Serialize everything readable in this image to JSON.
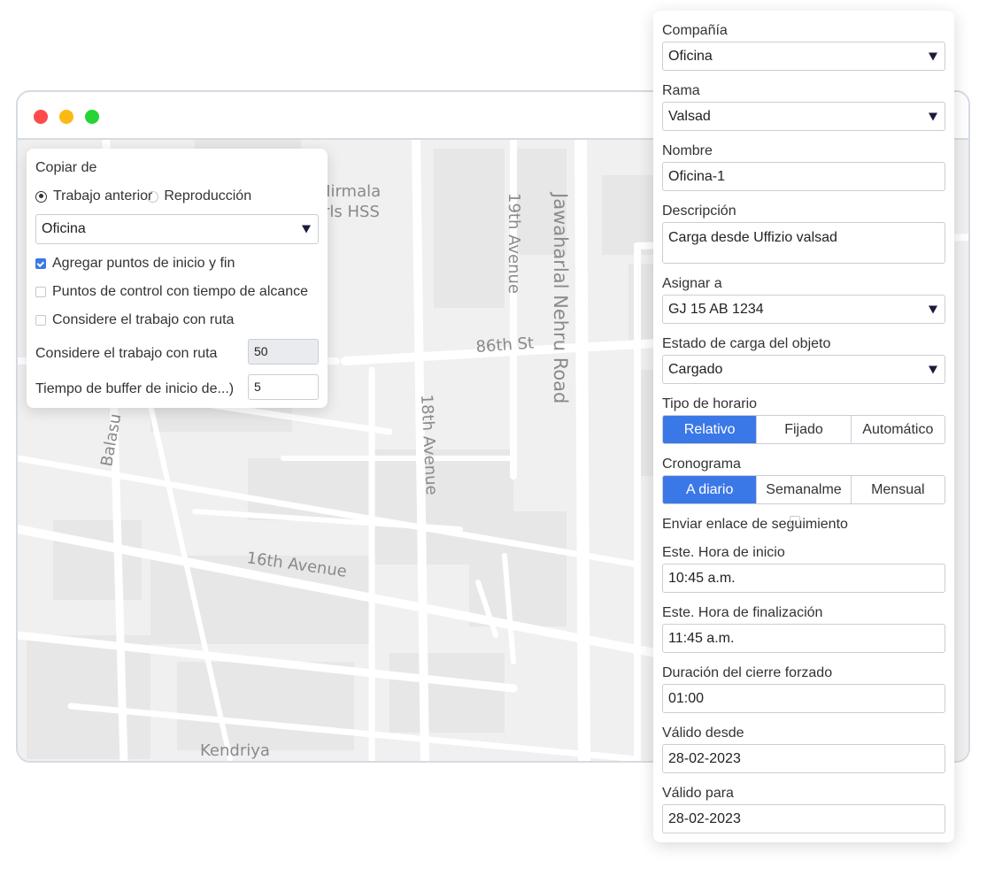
{
  "window": {
    "controls": [
      "close",
      "minimize",
      "maximize"
    ]
  },
  "map": {
    "labels": {
      "nirmala": "Nirmala",
      "girls_hss": "irls HSS",
      "nineteenth_avenue": "19th Avenue",
      "jawaharlal": "Jawaharlal Nehru Road",
      "eighty_sixth": "86th St",
      "eighteenth_avenue": "18th Avenue",
      "sixteenth_avenue": "16th Avenue",
      "balasu": "Balasu",
      "kendriya": "Kendriya"
    }
  },
  "copy_panel": {
    "title": "Copiar de",
    "radio_previous": "Trabajo anterior",
    "radio_playback": "Reproducción",
    "source_select": "Oficina",
    "check_add_points": "Agregar puntos de inicio y fin",
    "check_control_points": "Puntos de control con tiempo de alcance",
    "check_route_job": "Considere el trabajo con ruta",
    "route_job_label": "Considere el trabajo con ruta",
    "route_job_value": "50",
    "buffer_label": "Tiempo de buffer de inicio de...)",
    "buffer_value": "5"
  },
  "form": {
    "company_label": "Compañía",
    "company_value": "Oficina",
    "branch_label": "Rama",
    "branch_value": "Valsad",
    "name_label": "Nombre",
    "name_value": "Oficina-1",
    "description_label": "Descripción",
    "description_value": "Carga desde Uffizio valsad",
    "assign_label": "Asignar a",
    "assign_value": "GJ 15 AB 1234",
    "load_state_label": "Estado de carga del objeto",
    "load_state_value": "Cargado",
    "schedule_type_label": "Tipo de horario",
    "schedule_type_options": [
      "Relativo",
      "Fijado",
      "Automático"
    ],
    "schedule_label": "Cronograma",
    "schedule_options": [
      "A diario",
      "Semanalme",
      "Mensual"
    ],
    "tracking_link_label": "Enviar enlace de seguimiento",
    "start_time_label": "Este. Hora de inicio",
    "start_time_value": "10:45 a.m.",
    "end_time_label": "Este. Hora de finalización",
    "end_time_value": "11:45 a.m.",
    "force_close_label": "Duración del cierre forzado",
    "force_close_value": "01:00",
    "valid_from_label": "Válido desde",
    "valid_from_value": "28-02-2023",
    "valid_to_label": "Válido para",
    "valid_to_value": "28-02-2023"
  },
  "colors": {
    "accent": "#3b78e7",
    "close": "#fe4a4a",
    "minimize": "#fdb913",
    "maximize": "#26d435"
  }
}
